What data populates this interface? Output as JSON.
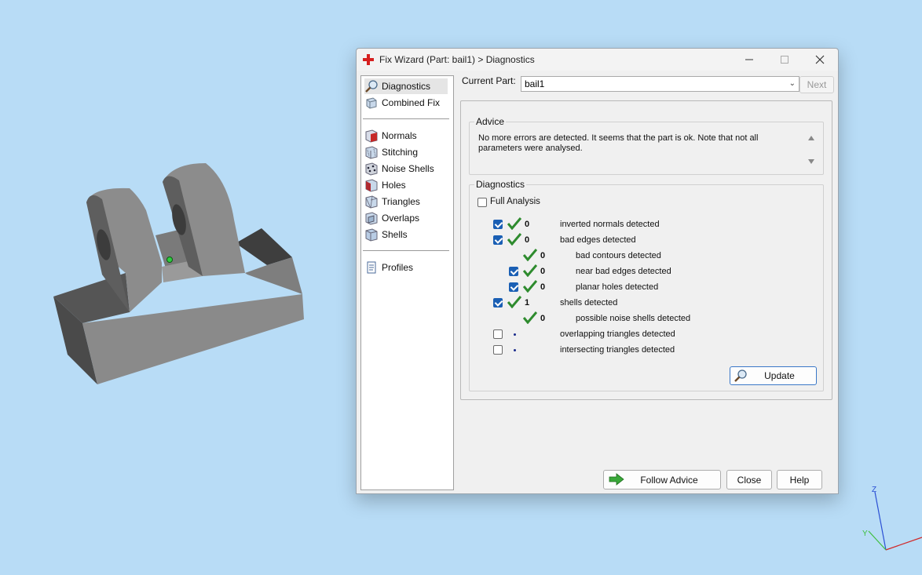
{
  "window": {
    "title": "Fix Wizard (Part: bail1) > Diagnostics"
  },
  "sidebar": {
    "items": [
      {
        "label": "Diagnostics",
        "icon": "magnifier-icon"
      },
      {
        "label": "Combined Fix",
        "icon": "box-icon"
      },
      {
        "label": "Normals",
        "icon": "normals-icon"
      },
      {
        "label": "Stitching",
        "icon": "stitching-icon"
      },
      {
        "label": "Noise Shells",
        "icon": "noise-shells-icon"
      },
      {
        "label": "Holes",
        "icon": "holes-icon"
      },
      {
        "label": "Triangles",
        "icon": "triangles-icon"
      },
      {
        "label": "Overlaps",
        "icon": "overlaps-icon"
      },
      {
        "label": "Shells",
        "icon": "shells-icon"
      },
      {
        "label": "Profiles",
        "icon": "document-icon"
      }
    ]
  },
  "current_part": {
    "label": "Current Part:",
    "value": "bail1"
  },
  "next_button": "Next",
  "advice": {
    "title": "Advice",
    "text": "No more errors are detected. It seems that the part is ok. Note that not all parameters were analysed."
  },
  "diagnostics": {
    "title": "Diagnostics",
    "full_analysis_label": "Full Analysis",
    "full_analysis_checked": false,
    "rows": [
      {
        "checked": true,
        "status": "ok",
        "count": "0",
        "label": "inverted normals detected"
      },
      {
        "checked": true,
        "status": "ok",
        "count": "0",
        "label": "bad edges detected"
      },
      {
        "checked": null,
        "status": "ok",
        "count": "0",
        "label": "bad contours detected"
      },
      {
        "checked": true,
        "status": "ok",
        "count": "0",
        "label": "near bad edges detected"
      },
      {
        "checked": true,
        "status": "ok",
        "count": "0",
        "label": "planar holes detected"
      },
      {
        "checked": true,
        "status": "ok",
        "count": "1",
        "label": "shells detected"
      },
      {
        "checked": null,
        "status": "ok",
        "count": "0",
        "label": "possible noise shells detected"
      },
      {
        "checked": false,
        "status": "none",
        "count": "",
        "label": "overlapping triangles detected"
      },
      {
        "checked": false,
        "status": "none",
        "count": "",
        "label": "intersecting triangles detected"
      }
    ],
    "update_button": "Update"
  },
  "footer": {
    "follow_advice": "Follow Advice",
    "close": "Close",
    "help": "Help"
  },
  "axes": {
    "z": "Z",
    "y": "Y"
  },
  "colors": {
    "ok_check": "#2e8b2e",
    "checkbox": "#1a5fb4",
    "background": "#b8dcf6"
  }
}
